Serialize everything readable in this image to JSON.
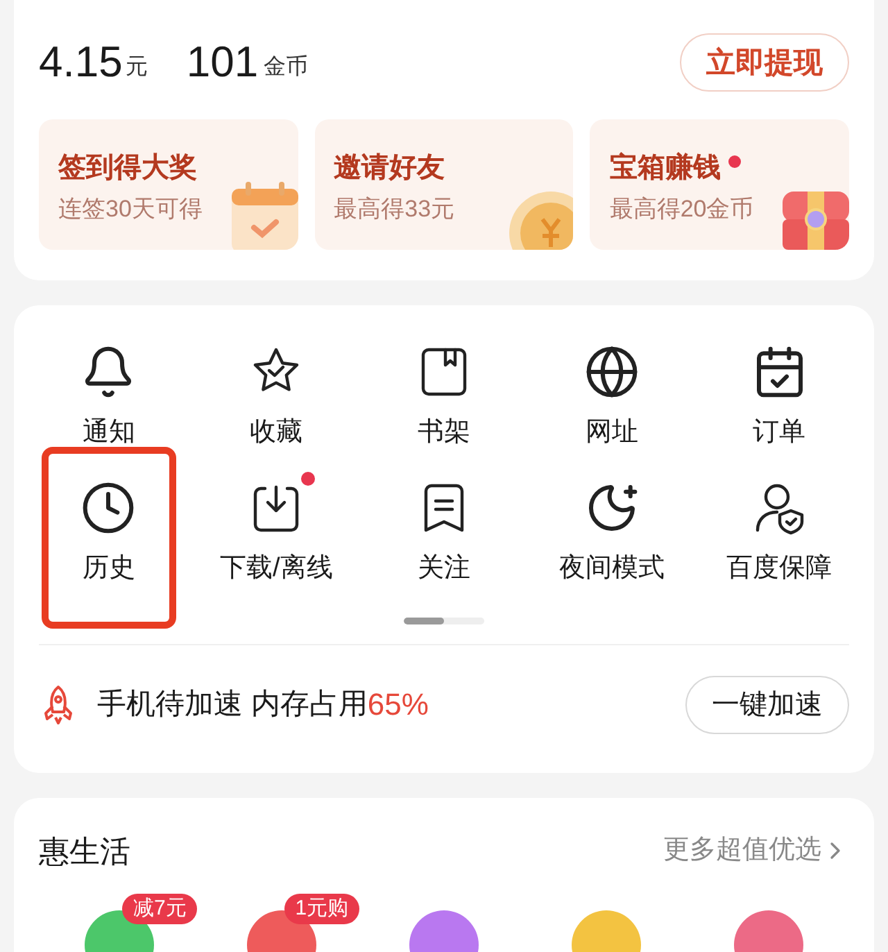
{
  "wallet": {
    "cash": "4.15",
    "cash_unit": "元",
    "coins": "101",
    "coins_unit": "金币",
    "withdraw_button": "立即提现"
  },
  "promos": [
    {
      "title": "签到得大奖",
      "subtitle": "连签30天可得",
      "dot": false
    },
    {
      "title": "邀请好友",
      "subtitle": "最高得33元",
      "dot": false
    },
    {
      "title": "宝箱赚钱",
      "subtitle": "最高得20金币",
      "dot": true
    }
  ],
  "tools": [
    {
      "label": "通知",
      "dot": false,
      "highlighted": false
    },
    {
      "label": "收藏",
      "dot": false,
      "highlighted": false
    },
    {
      "label": "书架",
      "dot": false,
      "highlighted": false
    },
    {
      "label": "网址",
      "dot": false,
      "highlighted": false
    },
    {
      "label": "订单",
      "dot": false,
      "highlighted": false
    },
    {
      "label": "历史",
      "dot": false,
      "highlighted": true
    },
    {
      "label": "下载/离线",
      "dot": true,
      "highlighted": false
    },
    {
      "label": "关注",
      "dot": false,
      "highlighted": false
    },
    {
      "label": "夜间模式",
      "dot": false,
      "highlighted": false
    },
    {
      "label": "百度保障",
      "dot": false,
      "highlighted": false
    }
  ],
  "page_indicator": {
    "level": 0.5
  },
  "speedup": {
    "text": "手机待加速 内存占用",
    "value": "65%",
    "button": "一键加速"
  },
  "life": {
    "title": "惠生活",
    "more": "更多超值优选",
    "items": [
      {
        "color": "#4cc76a",
        "badge": "减7元"
      },
      {
        "color": "#ee5b5b",
        "badge": "1元购"
      },
      {
        "color": "#b978f0"
      },
      {
        "color": "#f3c341"
      },
      {
        "color": "#ec6a86"
      }
    ]
  }
}
